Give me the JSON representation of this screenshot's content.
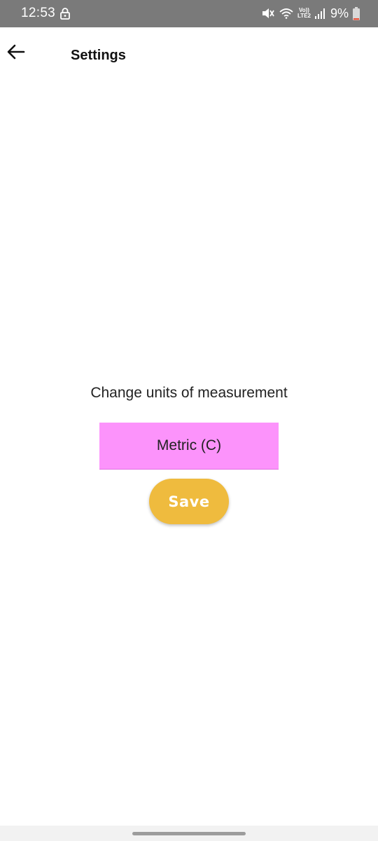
{
  "status_bar": {
    "time": "12:53",
    "network_top": "Vo))",
    "network_bottom": "LTE2",
    "battery": "9%",
    "icons": [
      "lock-icon",
      "mute-icon",
      "wifi-icon",
      "signal-icon",
      "battery-icon"
    ],
    "colors": {
      "background": "#7a7a7a",
      "battery_low": "#e8563f"
    }
  },
  "app_bar": {
    "back_icon": "arrow-left-icon",
    "title": "Settings"
  },
  "main": {
    "label": "Change units of measurement",
    "units_selected": "Metric (C)",
    "save_label": "Save"
  },
  "colors": {
    "dropdown_bg": "#fc93fb",
    "save_button_bg": "#efbb3e"
  }
}
